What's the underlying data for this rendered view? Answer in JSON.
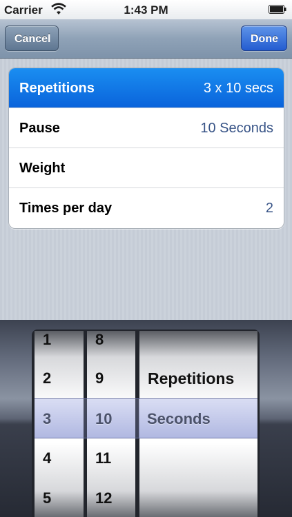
{
  "status": {
    "carrier": "Carrier",
    "time": "1:43 PM"
  },
  "nav": {
    "cancel": "Cancel",
    "done": "Done"
  },
  "rows": [
    {
      "label": "Repetitions",
      "value": "3 x 10 secs"
    },
    {
      "label": "Pause",
      "value": "10 Seconds"
    },
    {
      "label": "Weight",
      "value": ""
    },
    {
      "label": "Times per day",
      "value": "2"
    }
  ],
  "picker": {
    "col1": [
      "1",
      "2",
      "3",
      "4",
      "5"
    ],
    "col2": [
      "8",
      "9",
      "10",
      "11",
      "12"
    ],
    "col3": [
      "Repetitions",
      "Seconds"
    ],
    "selected": {
      "col1": "3",
      "col2": "10",
      "col3": "Seconds"
    }
  },
  "colors": {
    "accent": "#0a63db",
    "value_text": "#385487",
    "done_button": "#245cd0"
  },
  "icons": {
    "wifi": "wifi-icon",
    "battery": "battery-icon"
  }
}
